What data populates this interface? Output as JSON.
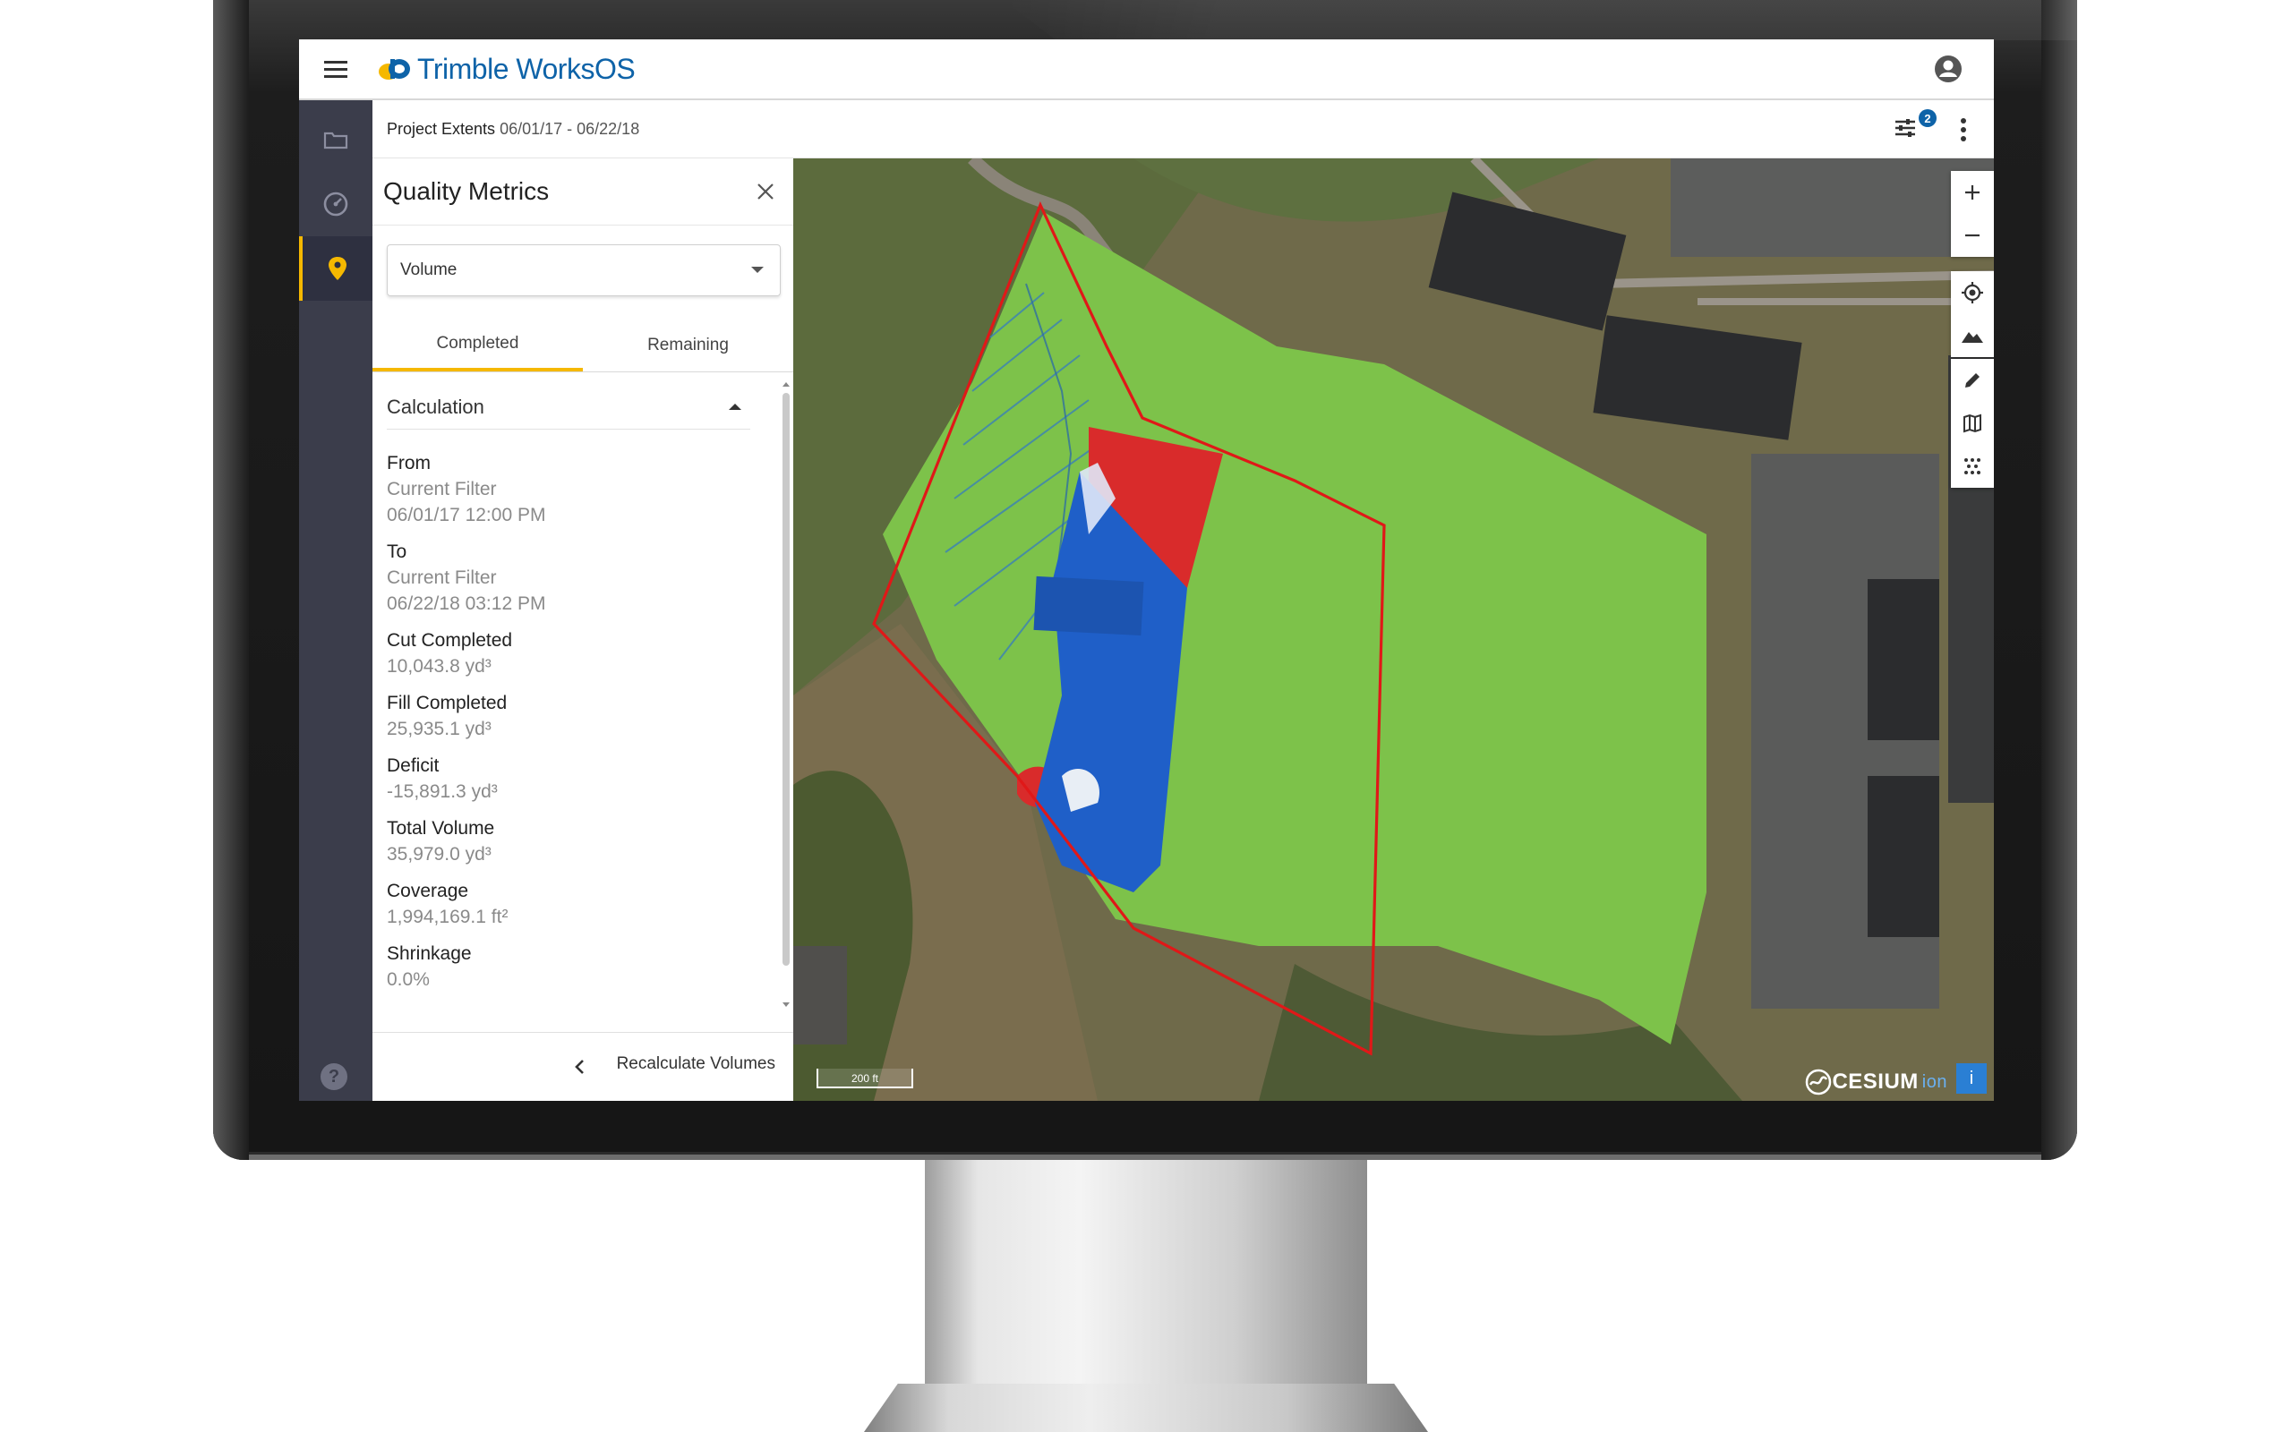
{
  "app": {
    "brand": "Trimble WorksOS",
    "brand_color": "#0e63a8",
    "accent_color": "#f5b800",
    "rail_color": "#3b3d4b"
  },
  "subbar": {
    "project_label": "Project Extents",
    "date_range": "06/01/17 - 06/22/18",
    "filter_count": "2"
  },
  "rail": {
    "items": [
      {
        "icon": "folder-icon"
      },
      {
        "icon": "dashboard-icon"
      },
      {
        "icon": "map-pin-icon",
        "active": true
      }
    ],
    "help": "?"
  },
  "panel": {
    "title": "Quality Metrics",
    "metric_select": "Volume",
    "tabs": [
      {
        "label": "Completed",
        "active": true
      },
      {
        "label": "Remaining",
        "active": false
      }
    ],
    "section_title": "Calculation",
    "metrics": [
      {
        "label": "From",
        "values": [
          "Current Filter",
          "06/01/17 12:00 PM"
        ]
      },
      {
        "label": "To",
        "values": [
          "Current Filter",
          "06/22/18 03:12 PM"
        ]
      },
      {
        "label": "Cut Completed",
        "values": [
          "10,043.8 yd³"
        ]
      },
      {
        "label": "Fill Completed",
        "values": [
          "25,935.1 yd³"
        ]
      },
      {
        "label": "Deficit",
        "values": [
          "-15,891.3 yd³"
        ]
      },
      {
        "label": "Total Volume",
        "values": [
          "35,979.0 yd³"
        ]
      },
      {
        "label": "Coverage",
        "values": [
          "1,994,169.1 ft²"
        ]
      },
      {
        "label": "Shrinkage",
        "values": [
          "0.0%"
        ]
      }
    ],
    "footer_action": "Recalculate Volumes"
  },
  "map": {
    "scale_label": "200 ft",
    "attribution": "CESIUM",
    "attribution_suffix": "ion",
    "info": "i",
    "tools": [
      "zoom-in-icon",
      "zoom-out-icon",
      "locate-icon",
      "terrain-icon",
      "pencil-icon",
      "map-layers-icon",
      "point-cloud-icon"
    ],
    "colors": {
      "fill_zone": "#7dc24a",
      "cut": "#d92b2b",
      "fill": "#1f5fc8",
      "boundary": "#e01818"
    }
  }
}
